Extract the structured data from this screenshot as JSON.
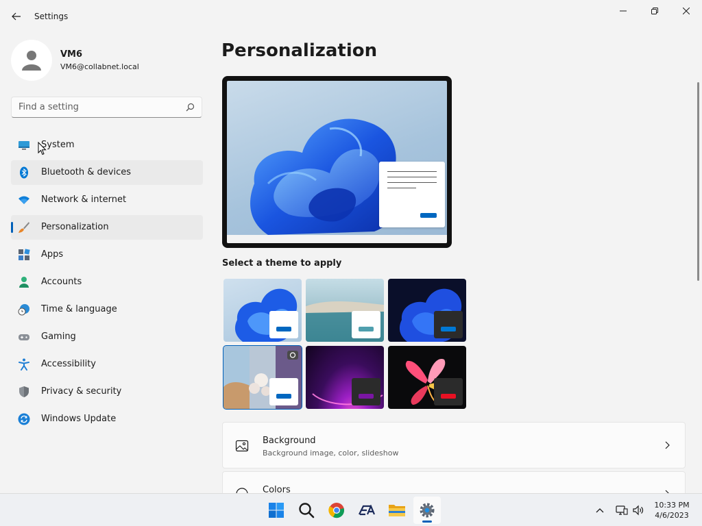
{
  "window": {
    "app_title": "Settings"
  },
  "user": {
    "name": "VM6",
    "email": "VM6@collabnet.local"
  },
  "search": {
    "placeholder": "Find a setting"
  },
  "sidebar": {
    "items": [
      {
        "label": "System",
        "icon": "monitor-icon"
      },
      {
        "label": "Bluetooth & devices",
        "icon": "bluetooth-icon"
      },
      {
        "label": "Network & internet",
        "icon": "wifi-icon"
      },
      {
        "label": "Personalization",
        "icon": "paintbrush-icon"
      },
      {
        "label": "Apps",
        "icon": "apps-icon"
      },
      {
        "label": "Accounts",
        "icon": "person-icon"
      },
      {
        "label": "Time & language",
        "icon": "globe-clock-icon"
      },
      {
        "label": "Gaming",
        "icon": "gamepad-icon"
      },
      {
        "label": "Accessibility",
        "icon": "accessibility-icon"
      },
      {
        "label": "Privacy & security",
        "icon": "shield-icon"
      },
      {
        "label": "Windows Update",
        "icon": "update-icon"
      }
    ],
    "selected": "Personalization"
  },
  "main": {
    "title": "Personalization",
    "themes_label": "Select a theme to apply",
    "themes": [
      {
        "name": "windows-light",
        "accent": "#0067c0",
        "swatch_bg": "#ffffff"
      },
      {
        "name": "glow",
        "accent": "#4f9fae",
        "swatch_bg": "#ffffff"
      },
      {
        "name": "windows-dark",
        "accent": "#0078d4",
        "swatch_bg": "#2b2b2b"
      },
      {
        "name": "captured-motion",
        "accent": "#0067c0",
        "swatch_bg": "#ffffff",
        "selected": true
      },
      {
        "name": "sunrise",
        "accent": "#7a16a3",
        "swatch_bg": "#2b2b2b"
      },
      {
        "name": "flow",
        "accent": "#e81123",
        "swatch_bg": "#2b2b2b"
      }
    ],
    "cards": [
      {
        "title": "Background",
        "subtitle": "Background image, color, slideshow",
        "icon": "image-icon"
      },
      {
        "title": "Colors",
        "subtitle": "",
        "icon": "palette-icon"
      }
    ]
  },
  "taskbar": {
    "apps": [
      "windows-start-icon",
      "search-icon",
      "chrome-icon",
      "ea-icon",
      "file-explorer-icon",
      "settings-icon"
    ],
    "active_app": "settings-icon",
    "time": "10:33 PM",
    "date": "4/6/2023"
  },
  "colors": {
    "accent": "#005fb8",
    "background": "#f3f3f3"
  }
}
